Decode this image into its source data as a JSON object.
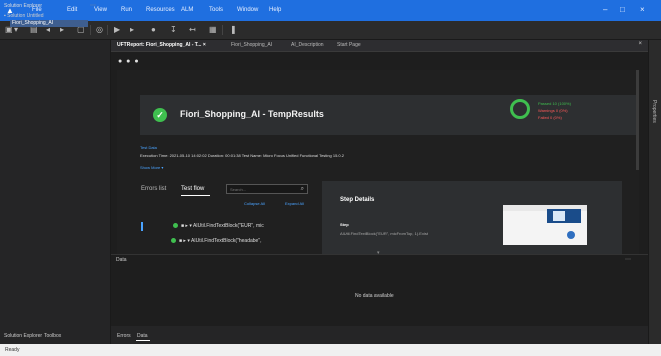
{
  "app": {
    "menu": [
      "File",
      "Edit",
      "View",
      "Run",
      "Resources",
      "ALM",
      "Tools",
      "Window",
      "Help"
    ]
  },
  "colors": {
    "accent": "#1f6fe0",
    "pass": "#3fbf4f",
    "warning": "#ff5a5a",
    "link": "#4aa3ff"
  },
  "icons": {
    "logo": "uft-logo-icon",
    "search": "search-icon",
    "check": "check-icon"
  },
  "solution_explorer": {
    "title": "Solution Explorer",
    "root": "Solution Untitled",
    "child": "Fiori_Shopping_AI"
  },
  "left_bottom_tabs": [
    "Solution Explorer",
    "Toolbox"
  ],
  "properties_label": "Properties",
  "doc_tabs": [
    {
      "label": "UFTReport: Fiori_Shopping_AI - T...  ×",
      "active": true
    },
    {
      "label": "Fiori_Shopping_AI",
      "active": false
    },
    {
      "label": "AI_Description",
      "active": false
    },
    {
      "label": "Start Page",
      "active": false
    }
  ],
  "report": {
    "title": "Fiori_Shopping_AI - TempResults",
    "stats": {
      "passed": "Passed   10 (100%)",
      "warnings": "Warnings   0   (0%)",
      "failed": "Failed   0   (0%)"
    },
    "meta_label": "Test Data",
    "meta_line": "Execution Time: 2021-05-10 14:02:02   Duration: 00:01:38   Test Name: Micro Focus Unified Functional Testing 15.0.2",
    "show_more": "Show More ▾"
  },
  "flow": {
    "tab_errors": "Errors list",
    "tab_flow": "Test flow",
    "search_placeholder": "Search...",
    "collapse_all": "Collapse All",
    "expand_all": "Expand All",
    "rows": [
      "AIUtil.FindTextBlock(\"EUR\", mic",
      "AIUtil.FindTextBlock(\"headabe\","
    ]
  },
  "step_details": {
    "title": "Step Details",
    "label": "Step",
    "value": "AIUtil.FindTextBlock(\"EUR\", micFromTop, 1).Exist"
  },
  "data_panel": {
    "title": "Data",
    "empty": "No data available"
  },
  "mid_bottom_tabs": [
    "Errors",
    "Data"
  ],
  "status": "Ready"
}
